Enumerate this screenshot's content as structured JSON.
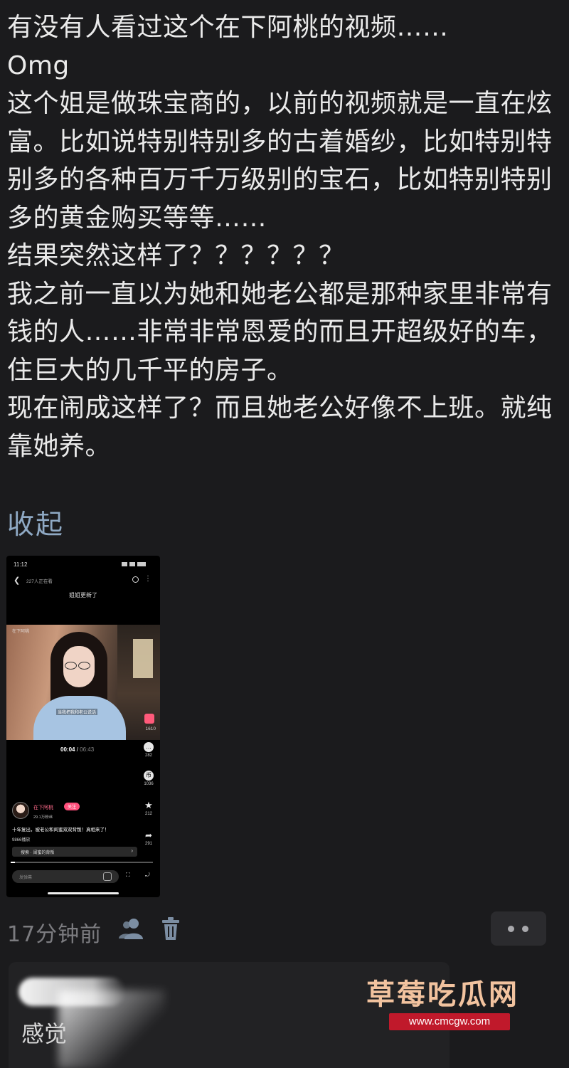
{
  "post": {
    "text": "有没有人看过这个在下阿桃的视频……\nOmg\n这个姐是做珠宝商的，以前的视频就是一直在炫富。比如说特别特别多的古着婚纱，比如特别特别多的各种百万千万级别的宝石，比如特别特别多的黄金购买等等……\n结果突然这样了？？？？？？\n我之前一直以为她和她老公都是那种家里非常有钱的人……非常非常恩爱的而且开超级好的车，住巨大的几千平的房子。\n现在闹成这样了？而且她老公好像不上班。就纯靠她养。",
    "collapse_label": "收起",
    "timestamp": "17分钟前"
  },
  "thumbnail": {
    "status_time": "11:12",
    "viewers": "227人正在看",
    "chat_title": "姐姐更新了",
    "video_watermark": "在下阿桃",
    "video_subtitle": "当我把我和老公说话",
    "like_count": "1610",
    "play_time": "00:04",
    "duration": "06:43",
    "comment_count": "282",
    "coin_count": "1036",
    "favorite_count": "212",
    "share_count": "291",
    "author_name": "在下阿桃",
    "follow_label": "关注",
    "fans": "29.1万粉丝",
    "description": "十年复出，被老公和闺蜜双双背叛！真相来了！",
    "plays": "9866播放",
    "search_query": "搜索 · 闺蜜的背叛",
    "comment_placeholder": "发弹幕",
    "progress": 0.01
  },
  "reply": {
    "text": "感觉"
  },
  "watermark": {
    "logo": "草莓吃瓜网",
    "url": "www.cmcgw.com"
  },
  "colors": {
    "background": "#1b1b1d",
    "link": "#8fa9c4",
    "meta": "#7c7c80",
    "accent_pink": "#ff4f7b",
    "url_badge": "#c0192b"
  }
}
